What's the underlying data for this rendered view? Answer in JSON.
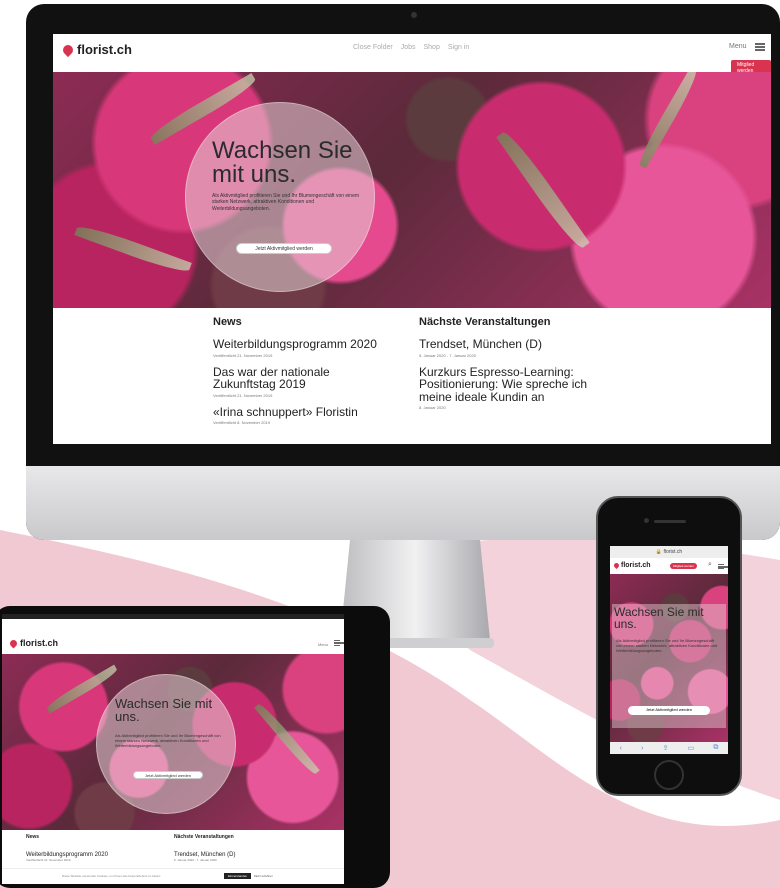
{
  "logo": {
    "text": "florist.ch"
  },
  "nav": {
    "items": [
      "Close Folder",
      "Jobs",
      "Shop",
      "Sign in"
    ],
    "menu_label": "Menu",
    "corner_button": "Mitglied werden"
  },
  "hero": {
    "headline_desktop": "Wachsen Sie mit uns.",
    "headline_line1": "Wachsen Sie",
    "headline_line2": "mit uns.",
    "body": "Als Aktivmitglied profitieren Sie und Ihr Blumengeschäft von einem starken Netzwerk, attraktiven Konditionen und Weiterbildungsangeboten.",
    "cta": "Jetzt Aktivmitglied werden"
  },
  "news": {
    "title": "News",
    "items": [
      {
        "title": "Weiterbildungsprogramm 2020",
        "date": "Veröffentlicht 21. November 2019"
      },
      {
        "title": "Das war der nationale Zukunftstag 2019",
        "date": "Veröffentlicht 21. November 2019"
      },
      {
        "title": "«Irina schnuppert» Floristin",
        "date": "Veröffentlicht 8. November 2019"
      }
    ]
  },
  "events": {
    "title": "Nächste Veranstaltungen",
    "items": [
      {
        "title": "Trendset, München (D)",
        "date": "5. Januar 2020 - 7. Januar 2020"
      },
      {
        "title": "Kurzkurs Espresso-Learning: Positionierung: Wie spreche ich meine ideale Kundin an",
        "date": "8. Januar 2020"
      }
    ]
  },
  "tablet": {
    "cookie_text": "Diese Website verwendet Cookies, um Ihnen das beste Erlebnis zu bieten.",
    "cookie_accept": "Einverstanden",
    "cookie_more": "Mehr erfahren"
  },
  "phone": {
    "url": "florist.ch",
    "pill": "Mitglied werden"
  },
  "colors": {
    "accent": "#d8344f",
    "pink_bg": "#f1c9d3",
    "hero_magenta": "#c92c6e"
  }
}
